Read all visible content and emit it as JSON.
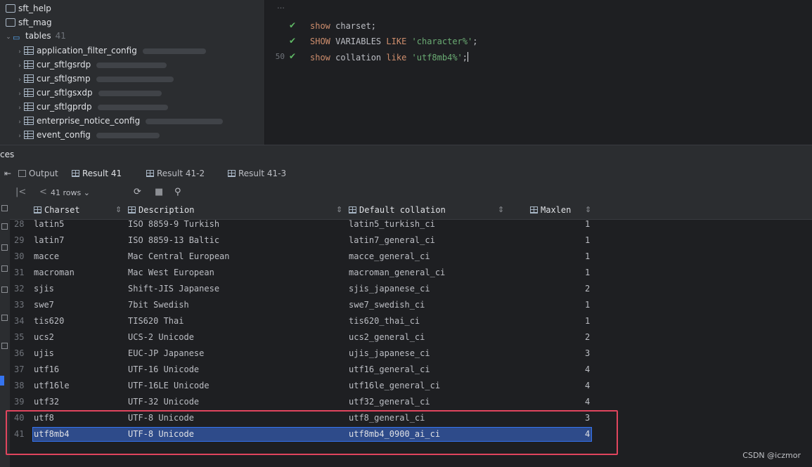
{
  "tree": {
    "items": [
      {
        "label": "sft_help",
        "kind": "schema"
      },
      {
        "label": "sft_mag",
        "kind": "schema"
      },
      {
        "label": "tables",
        "kind": "folder",
        "count": "41"
      },
      {
        "label": "application_filter_config",
        "kind": "table"
      },
      {
        "label": "cur_sftlgsrdp",
        "kind": "table"
      },
      {
        "label": "cur_sftlgsmp",
        "kind": "table"
      },
      {
        "label": "cur_sftlgsxdp",
        "kind": "table"
      },
      {
        "label": "cur_sftlgprdp",
        "kind": "table"
      },
      {
        "label": "enterprise_notice_config",
        "kind": "table"
      },
      {
        "label": "event_config",
        "kind": "table"
      }
    ]
  },
  "editor": {
    "lines": [
      {
        "num": "",
        "check": true,
        "code": [
          {
            "t": "kw",
            "v": "show"
          },
          {
            "t": "",
            "v": " charset;"
          }
        ]
      },
      {
        "num": "",
        "check": true,
        "code": [
          {
            "t": "kw",
            "v": "SHOW"
          },
          {
            "t": "",
            "v": " VARIABLES "
          },
          {
            "t": "kw",
            "v": "LIKE"
          },
          {
            "t": "",
            "v": " "
          },
          {
            "t": "str",
            "v": "'character%'"
          },
          {
            "t": "",
            "v": ";"
          }
        ]
      },
      {
        "num": "50",
        "check": true,
        "code": [
          {
            "t": "kw",
            "v": "show"
          },
          {
            "t": "",
            "v": " collation "
          },
          {
            "t": "kw",
            "v": "like"
          },
          {
            "t": "",
            "v": " "
          },
          {
            "t": "str",
            "v": "'utf8mb4%'"
          },
          {
            "t": "",
            "v": ";"
          }
        ]
      }
    ]
  },
  "services": {
    "label": "ces"
  },
  "tabs": [
    {
      "label": "Output",
      "active": false
    },
    {
      "label": "Result 41",
      "active": true
    },
    {
      "label": "Result 41-2",
      "active": false
    },
    {
      "label": "Result 41-3",
      "active": false
    }
  ],
  "toolbar": {
    "rows_label": "41 rows"
  },
  "grid": {
    "columns": [
      "Charset",
      "Description",
      "Default collation",
      "Maxlen"
    ],
    "rows": [
      {
        "num": "28",
        "charset": "latin5",
        "description": "ISO 8859-9 Turkish",
        "collation": "latin5_turkish_ci",
        "maxlen": "1"
      },
      {
        "num": "29",
        "charset": "latin7",
        "description": "ISO 8859-13 Baltic",
        "collation": "latin7_general_ci",
        "maxlen": "1"
      },
      {
        "num": "30",
        "charset": "macce",
        "description": "Mac Central European",
        "collation": "macce_general_ci",
        "maxlen": "1"
      },
      {
        "num": "31",
        "charset": "macroman",
        "description": "Mac West European",
        "collation": "macroman_general_ci",
        "maxlen": "1"
      },
      {
        "num": "32",
        "charset": "sjis",
        "description": "Shift-JIS Japanese",
        "collation": "sjis_japanese_ci",
        "maxlen": "2"
      },
      {
        "num": "33",
        "charset": "swe7",
        "description": "7bit Swedish",
        "collation": "swe7_swedish_ci",
        "maxlen": "1"
      },
      {
        "num": "34",
        "charset": "tis620",
        "description": "TIS620 Thai",
        "collation": "tis620_thai_ci",
        "maxlen": "1"
      },
      {
        "num": "35",
        "charset": "ucs2",
        "description": "UCS-2 Unicode",
        "collation": "ucs2_general_ci",
        "maxlen": "2"
      },
      {
        "num": "36",
        "charset": "ujis",
        "description": "EUC-JP Japanese",
        "collation": "ujis_japanese_ci",
        "maxlen": "3"
      },
      {
        "num": "37",
        "charset": "utf16",
        "description": "UTF-16 Unicode",
        "collation": "utf16_general_ci",
        "maxlen": "4"
      },
      {
        "num": "38",
        "charset": "utf16le",
        "description": "UTF-16LE Unicode",
        "collation": "utf16le_general_ci",
        "maxlen": "4"
      },
      {
        "num": "39",
        "charset": "utf32",
        "description": "UTF-32 Unicode",
        "collation": "utf32_general_ci",
        "maxlen": "4"
      },
      {
        "num": "40",
        "charset": "utf8",
        "description": "UTF-8 Unicode",
        "collation": "utf8_general_ci",
        "maxlen": "3"
      },
      {
        "num": "41",
        "charset": "utf8mb4",
        "description": "UTF-8 Unicode",
        "collation": "utf8mb4_0900_ai_ci",
        "maxlen": "4",
        "selected": true
      }
    ]
  },
  "watermark": "CSDN @iczmor",
  "colors": {
    "accent": "#3574f0",
    "highlight": "#e0455e",
    "selection": "#2e4b8a"
  }
}
